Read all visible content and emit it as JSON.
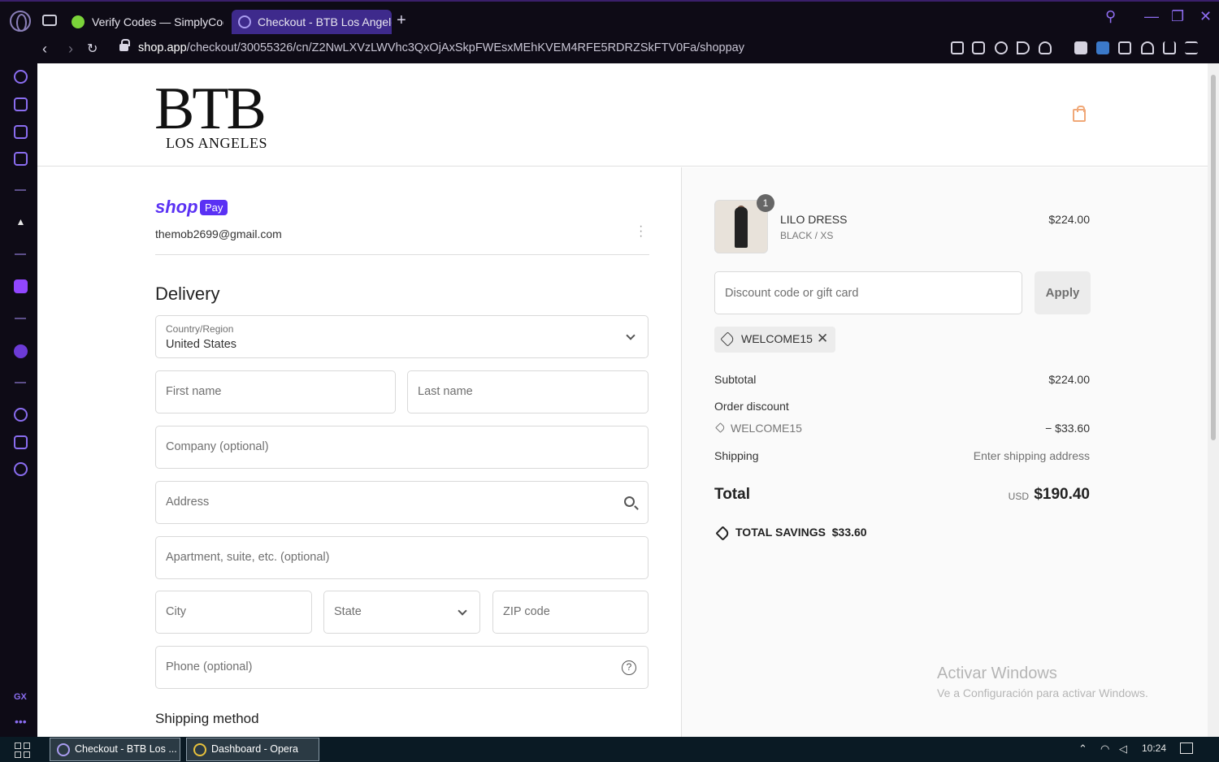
{
  "browser": {
    "tabs": [
      {
        "label": "Verify Codes — SimplyCodes"
      },
      {
        "label": "Checkout - BTB Los Angeles"
      }
    ],
    "new_tab": "+",
    "url_host": "shop.app",
    "url_path": "/checkout/30055326/cn/Z2NwLXVzLWVhc3QxOjAxSkpFWEsxMEhKVEM4RFE5RDRZSkFTV0Fa/shoppay"
  },
  "store": {
    "logo_main": "BTB",
    "logo_sub": "LOS ANGELES"
  },
  "checkout": {
    "shop_label": "shop",
    "pay_badge": "Pay",
    "email": "themob2699@gmail.com",
    "delivery_title": "Delivery",
    "country": {
      "label": "Country/Region",
      "value": "United States"
    },
    "fields": {
      "first_name": "First name",
      "last_name": "Last name",
      "company": "Company (optional)",
      "address": "Address",
      "apartment": "Apartment, suite, etc. (optional)",
      "city": "City",
      "state": "State",
      "zip": "ZIP code",
      "phone": "Phone (optional)"
    },
    "shipping_method_title": "Shipping method"
  },
  "summary": {
    "item": {
      "quantity": "1",
      "name": "LILO DRESS",
      "variant": "BLACK / XS",
      "price": "$224.00"
    },
    "discount_placeholder": "Discount code or gift card",
    "apply_label": "Apply",
    "applied_code": "WELCOME15",
    "subtotal_label": "Subtotal",
    "subtotal_value": "$224.00",
    "order_discount_label": "Order discount",
    "order_discount_code": "WELCOME15",
    "order_discount_value": "− $33.60",
    "shipping_label": "Shipping",
    "shipping_value": "Enter shipping address",
    "total_label": "Total",
    "currency": "USD",
    "total_value": "$190.40",
    "savings_label": "TOTAL SAVINGS",
    "savings_value": "$33.60"
  },
  "watermark": {
    "line1": "Activar Windows",
    "line2": "Ve a Configuración para activar Windows."
  },
  "taskbar": {
    "items": [
      {
        "label": "Checkout - BTB Los ..."
      },
      {
        "label": "Dashboard - Opera"
      }
    ],
    "time": "10:24"
  }
}
